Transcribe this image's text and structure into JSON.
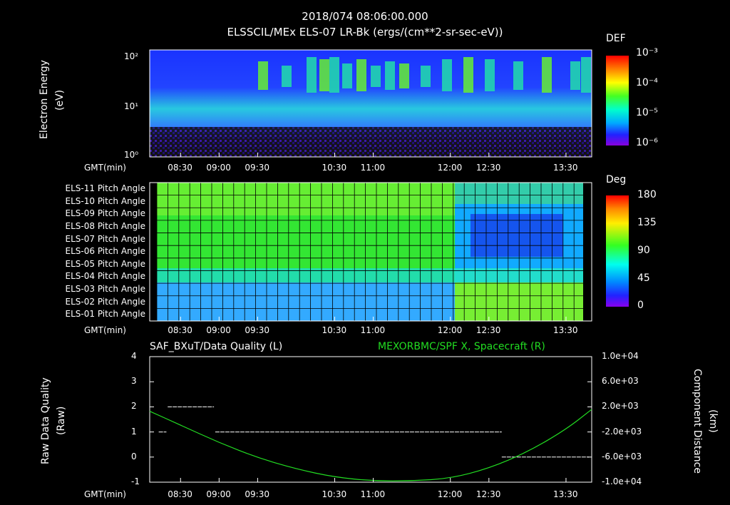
{
  "header": {
    "timestamp": "2018/074 08:06:00.000",
    "subtitle": "ELSSCIL/MEx ELS-07 LR-Bk  (ergs/(cm**2-sr-sec-eV))"
  },
  "panel1": {
    "ylabel_line1": "Electron Energy",
    "ylabel_line2": "(eV)",
    "yticks": [
      "10²",
      "10¹",
      "10⁰"
    ],
    "colorbar_title": "DEF",
    "colorbar_ticks": [
      "10⁻³",
      "10⁻⁴",
      "10⁻⁵",
      "10⁻⁶"
    ],
    "time_label": "GMT(min)"
  },
  "panel2": {
    "rows": [
      "ELS-11 Pitch Angle",
      "ELS-10 Pitch Angle",
      "ELS-09 Pitch Angle",
      "ELS-08 Pitch Angle",
      "ELS-07 Pitch Angle",
      "ELS-06 Pitch Angle",
      "ELS-05 Pitch Angle",
      "ELS-04 Pitch Angle",
      "ELS-03 Pitch Angle",
      "ELS-02 Pitch Angle",
      "ELS-01 Pitch Angle"
    ],
    "colorbar_title": "Deg",
    "colorbar_ticks": [
      "180",
      "135",
      "90",
      "45",
      "0"
    ],
    "time_label": "GMT(min)"
  },
  "panel3": {
    "left_title": "SAF_BXuT/Data Quality (L)",
    "right_title": "MEXORBMC/SPF X, Spacecraft (R)",
    "ylabel_left_line1": "Raw Data Quality",
    "ylabel_left_line2": "(Raw)",
    "ylabel_right_line1": "Component Distance",
    "ylabel_right_line2": "(km)",
    "yticks_left": [
      "4",
      "3",
      "2",
      "1",
      "0",
      "-1"
    ],
    "yticks_right": [
      "1.0e+04",
      "6.0e+03",
      "2.0e+03",
      "-2.0e+03",
      "-6.0e+03",
      "-1.0e+04"
    ],
    "time_label": "GMT(min)",
    "right_color": "#22dd22"
  },
  "time_ticks": [
    "08:30",
    "09:00",
    "09:30",
    "10:30",
    "11:00",
    "12:00",
    "12:30",
    "13:30"
  ],
  "chart_data": [
    {
      "type": "heatmap",
      "ylabel": "Electron Energy (eV)",
      "y_scale": "log",
      "ylim": [
        1,
        150
      ],
      "colorbar": "DEF",
      "colorbar_range": [
        1e-06,
        0.001
      ],
      "x_start": "08:06",
      "x_end": "13:50"
    },
    {
      "type": "heatmap",
      "rows": [
        "ELS-11",
        "ELS-10",
        "ELS-09",
        "ELS-08",
        "ELS-07",
        "ELS-06",
        "ELS-05",
        "ELS-04",
        "ELS-03",
        "ELS-02",
        "ELS-01"
      ],
      "colorbar": "Deg",
      "colorbar_range": [
        0,
        180
      ],
      "x_start": "08:06",
      "x_end": "13:50"
    },
    {
      "type": "line",
      "x_start": "08:06",
      "x_end": "13:50",
      "ylim_left": [
        -1,
        4
      ],
      "ylim_right": [
        -10000,
        10000
      ],
      "series": [
        {
          "name": "SAF_BXuT/Data Quality",
          "axis": "left",
          "segments": [
            {
              "from": "08:13",
              "to": "08:19",
              "value": 1
            },
            {
              "from": "08:20",
              "to": "08:56",
              "value": 2
            },
            {
              "from": "08:57",
              "to": "12:40",
              "value": 1
            },
            {
              "from": "12:40",
              "to": "13:48",
              "value": 0
            }
          ]
        },
        {
          "name": "MEXORBMC/SPF X, Spacecraft",
          "axis": "right",
          "x": [
            "08:06",
            "08:30",
            "09:00",
            "09:30",
            "10:00",
            "10:30",
            "11:00",
            "11:30",
            "12:00",
            "12:30",
            "13:00",
            "13:30",
            "13:50"
          ],
          "values": [
            1300,
            -900,
            -3700,
            -6100,
            -7900,
            -9200,
            -9800,
            -9800,
            -9400,
            -7800,
            -5200,
            -1600,
            1600
          ]
        }
      ]
    }
  ]
}
